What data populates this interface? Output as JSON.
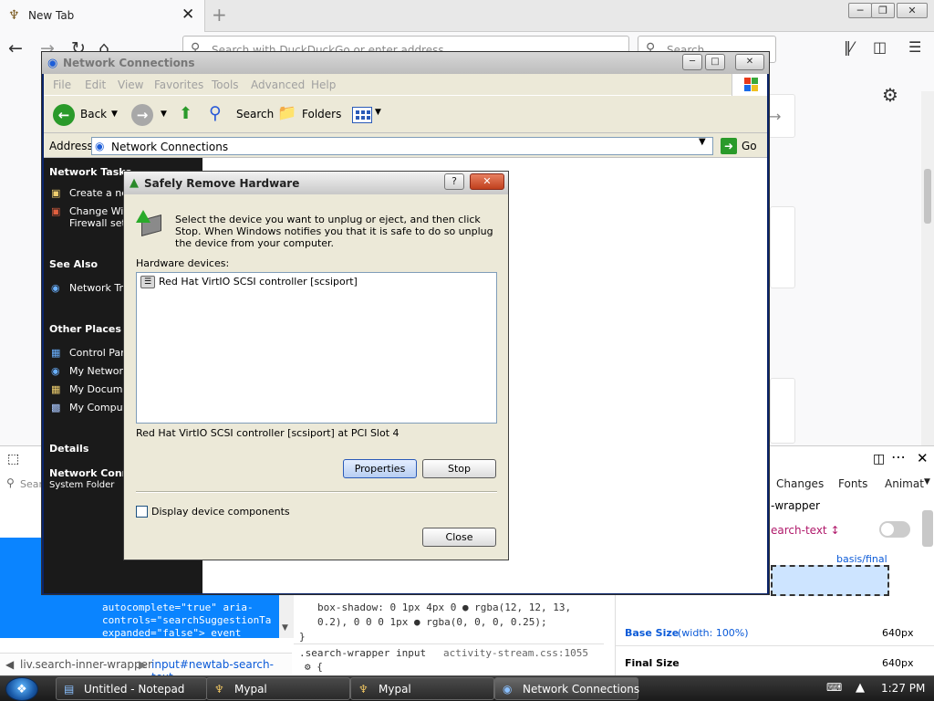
{
  "browser": {
    "tab_title": "New Tab",
    "url_placeholder": "Search with DuckDuckGo or enter address",
    "search_placeholder": "Search",
    "devtools": {
      "right_tabs": [
        "Changes",
        "Fonts",
        "Animat"
      ],
      "wrapper_label": "-wrapper",
      "search_text_sel": "earch-text ↕",
      "basis_final": "basis/final",
      "base_size_label": "Base Size",
      "base_size_note": "(width: 100%)",
      "base_size_value": "640px",
      "final_size_label": "Final Size",
      "final_size_value": "640px",
      "search_placeholder": "Sear",
      "html_lines": [
        "autocomplete=\"true\" aria-",
        "controls=\"searchSuggestionTa",
        "expanded=\"false\"> event"
      ],
      "css_line1": "box-shadow: 0 1px 4px 0 ● rgba(12, 12, 13,",
      "css_line2": "0.2), 0 0 0 1px ● rgba(0, 0, 0, 0.25);",
      "css_line3": "}",
      "css_selector": ".search-wrapper input",
      "css_source": "activity-stream.css:1055",
      "css_line5": "⚙ {",
      "breadcrumb_1": "liv.search-inner-wrapper",
      "breadcrumb_2": "input#newtab-search-text"
    }
  },
  "network_window": {
    "title": "Network Connections",
    "menu": [
      "File",
      "Edit",
      "View",
      "Favorites",
      "Tools",
      "Advanced",
      "Help"
    ],
    "toolbar": {
      "back": "Back",
      "search": "Search",
      "folders": "Folders"
    },
    "address_label": "Address",
    "address_value": "Network Connections",
    "go_label": "Go",
    "task_pane": {
      "network_tasks": "Network Tasks",
      "nt_items": [
        "Create a new",
        "Change Win",
        "Firewall sett"
      ],
      "see_also": "See Also",
      "sa_items": [
        "Network Tro"
      ],
      "other_places": "Other Places",
      "op_items": [
        "Control Pan",
        "My Network",
        "My Docume",
        "My Comput"
      ],
      "details": "Details",
      "details_title": "Network Conne",
      "details_sub": "System Folder"
    }
  },
  "dialog": {
    "title": "Safely Remove Hardware",
    "help_btn": "?",
    "close_btn": "✕",
    "instructions": "Select the device you want to unplug or eject, and then click Stop. When Windows notifies you that it is safe to do so unplug the device from your computer.",
    "devices_label": "Hardware devices:",
    "devices": [
      "Red Hat VirtIO SCSI controller [scsiport]"
    ],
    "device_description": "Red Hat VirtIO SCSI controller [scsiport] at PCI Slot 4",
    "properties_button": "Properties",
    "stop_button": "Stop",
    "show_components_label": "Display device components",
    "show_components_checked": false,
    "close_button": "Close"
  },
  "taskbar": {
    "items": [
      "Untitled - Notepad",
      "Mypal",
      "Mypal",
      "Network Connections"
    ],
    "clock": "1:27 PM"
  },
  "colors": {
    "accent": "#0a84ff",
    "xp_taskpane": "#1a1a1a",
    "dialog_bg": "#ece9d8"
  }
}
